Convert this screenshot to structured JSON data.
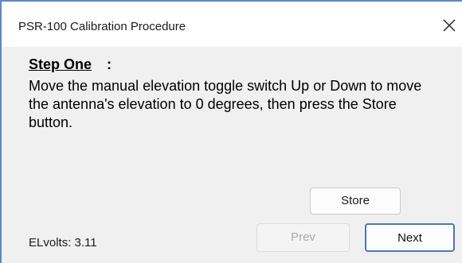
{
  "window": {
    "title": "PSR-100 Calibration Procedure",
    "close_icon": "close-icon"
  },
  "step": {
    "heading": "Step One",
    "colon": ":",
    "instructions": "Move the manual elevation toggle switch Up or Down to move the antenna's elevation to 0 degrees, then press the Store button."
  },
  "buttons": {
    "store_label": "Store",
    "prev_label": "Prev",
    "prev_enabled": false,
    "next_label": "Next"
  },
  "status": {
    "elvolts_text": "ELvolts: 3.11"
  },
  "colors": {
    "accent": "#4a78c0",
    "window_border": "#5b87c9",
    "body_bg": "#f0f0f0"
  }
}
